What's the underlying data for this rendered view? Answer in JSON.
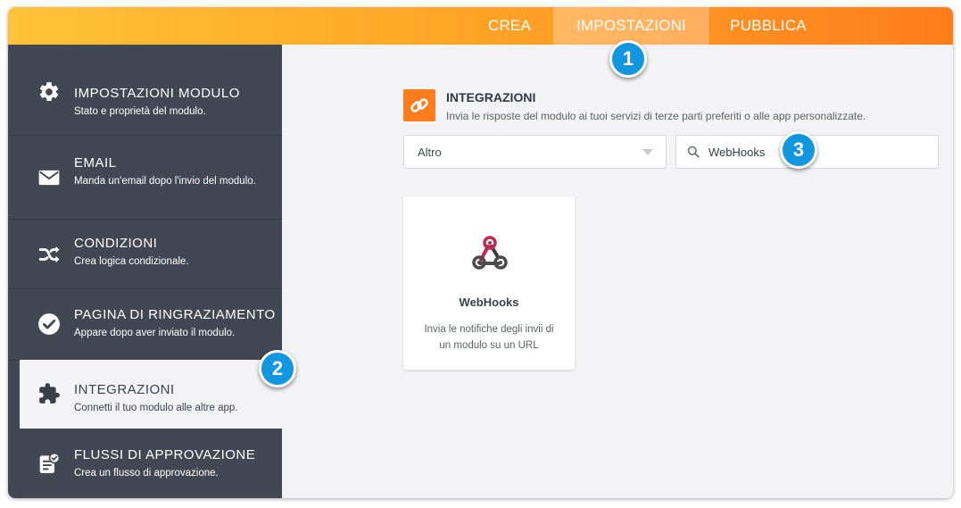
{
  "topbar": {
    "tabs": [
      {
        "label": "CREA"
      },
      {
        "label": "IMPOSTAZIONI"
      },
      {
        "label": "PUBBLICA"
      }
    ],
    "active_tab": "IMPOSTAZIONI",
    "gradient_colors": [
      "#ffc23a",
      "#ff7d1c"
    ]
  },
  "sidebar": {
    "items": [
      {
        "title": "IMPOSTAZIONI MODULO",
        "desc": "Stato e proprietà del modulo.",
        "icon": "gear-icon"
      },
      {
        "title": "EMAIL",
        "desc": "Manda un'email dopo l'invio del modulo.",
        "icon": "envelope-icon"
      },
      {
        "title": "CONDIZIONI",
        "desc": "Crea logica condizionale.",
        "icon": "shuffle-icon"
      },
      {
        "title": "PAGINA DI RINGRAZIAMENTO",
        "desc": "Appare dopo aver inviato il modulo.",
        "icon": "check-circle-icon"
      },
      {
        "title": "INTEGRAZIONI",
        "desc": "Connetti il tuo modulo alle altre app.",
        "icon": "puzzle-icon",
        "active": true
      },
      {
        "title": "FLUSSI DI APPROVAZIONE",
        "desc": "Crea un flusso di approvazione.",
        "icon": "approval-icon"
      }
    ],
    "background_color": "#424853"
  },
  "integrations": {
    "title": "INTEGRAZIONI",
    "description": "Invia le risposte del modulo ai tuoi servizi di terze parti preferiti o alle app personalizzate.",
    "icon": "link-icon",
    "accent_color": "#ff7b1c",
    "category_select": {
      "value": "Altro"
    },
    "search": {
      "value": "WebHooks",
      "icon": "search-icon"
    }
  },
  "cards": [
    {
      "name": "WebHooks",
      "desc": "Invia le notifiche degli invii di un modulo su un URL",
      "icon": "webhooks-icon"
    }
  ],
  "badges": [
    {
      "label": "1"
    },
    {
      "label": "2"
    },
    {
      "label": "3"
    }
  ],
  "badge_color": "#1197e0"
}
